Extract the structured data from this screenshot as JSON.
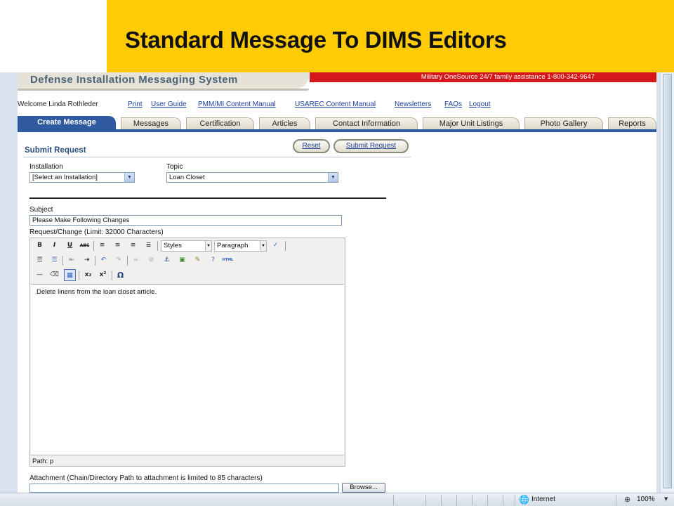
{
  "slide": {
    "title": "Standard Message To DIMS Editors"
  },
  "site": {
    "title": "Defense Installation Messaging System",
    "onesource": "Military OneSource 24/7 family assistance 1-800-342-9647",
    "welcome": "Welcome Linda Rothleder",
    "links": [
      "Print",
      "User Guide",
      "PMM/MI Content Manual",
      "USAREC Content Manual",
      "Newsletters",
      "FAQs",
      "Logout"
    ]
  },
  "tabs": [
    "Create Message",
    "Messages",
    "Certification",
    "Articles",
    "Contact Information",
    "Major Unit Listings",
    "Photo Gallery",
    "Reports"
  ],
  "active_tab": "Create Message",
  "form": {
    "heading": "Submit Request",
    "reset_label": "Reset",
    "submit_label": "Submit Request",
    "installation_label": "Installation",
    "installation_value": "[Select an Installation]",
    "topic_label": "Topic",
    "topic_value": "Loan Closet",
    "subject_label": "Subject",
    "subject_value": "Please Make Following Changes",
    "request_label": "Request/Change (Limit: 32000 Characters)",
    "attachment_label": "Attachment (Chain/Directory Path to attachment is limited to 85 characters)",
    "browse_label": "Browse..."
  },
  "editor": {
    "styles_value": "Styles",
    "format_value": "Paragraph",
    "body_text": "Delete linens from the loan closet article.",
    "path_text": "Path: p"
  },
  "status": {
    "zone": "Internet",
    "zoom": "100%"
  }
}
